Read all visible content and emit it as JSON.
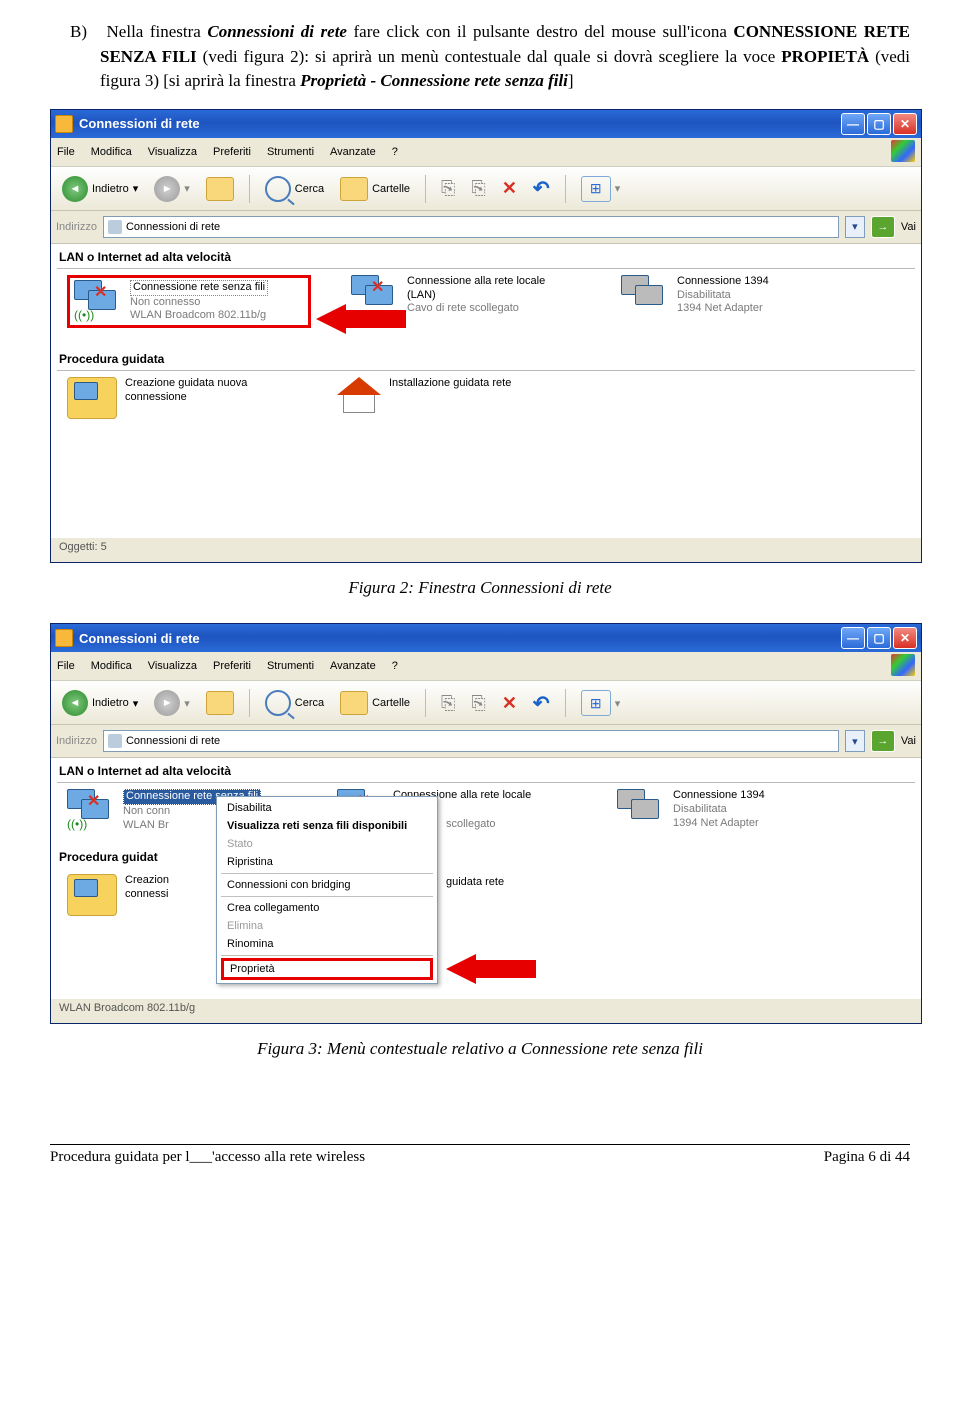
{
  "para": {
    "label": "B)",
    "t1": "Nella finestra ",
    "t2": "Connessioni di rete",
    "t3": " fare click con il pulsante destro del mouse sull'icona ",
    "t4": "CONNESSIONE RETE SENZA FILI",
    "t5": " (vedi figura 2): si aprirà un menù contestuale dal quale si dovrà scegliere la voce ",
    "t6": "PROPIETÀ",
    "t7": " (vedi figura 3) [si aprirà la finestra ",
    "t8": "Proprietà - Connessione rete senza fili",
    "t9": "]"
  },
  "win": {
    "title": "Connessioni di rete",
    "menu": [
      "File",
      "Modifica",
      "Visualizza",
      "Preferiti",
      "Strumenti",
      "Avanzate",
      "?"
    ],
    "back": "Indietro",
    "search": "Cerca",
    "folders": "Cartelle",
    "addr_label": "Indirizzo",
    "addr_value": "Connessioni di rete",
    "go": "Vai",
    "section1": "LAN o Internet ad alta velocità",
    "section2": "Procedura guidata",
    "conn1": {
      "l1": "Connessione rete senza fili",
      "l2": "Non connesso",
      "l3": "WLAN Broadcom 802.11b/g"
    },
    "conn2": {
      "l1": "Connessione alla rete locale",
      "l1b": "(LAN)",
      "l2": "Cavo di rete scollegato"
    },
    "conn3": {
      "l1": "Connessione 1394",
      "l2": "Disabilitata",
      "l3": "1394 Net Adapter"
    },
    "wiz1": {
      "l1": "Creazione guidata nuova",
      "l2": "connessione"
    },
    "wiz2": {
      "l1": "Installazione guidata rete"
    },
    "status1": "Oggetti: 5",
    "status2": "WLAN Broadcom 802.11b/g",
    "conn1_short2": "Non conn",
    "conn1_short3": "WLAN Br",
    "conn2_full": "Connessione alla rete locale",
    "conn2_partial": "scollegato",
    "wiz1_short1": "Creazion",
    "wiz1_short2": "connessi",
    "wiz2_partial": "guidata rete",
    "section2_short": "Procedura guidat"
  },
  "ctx": {
    "items": [
      "Disabilita",
      "Visualizza reti senza fili disponibili",
      "Stato",
      "Ripristina",
      "Connessioni con bridging",
      "Crea collegamento",
      "Elimina",
      "Rinomina",
      "Proprietà"
    ]
  },
  "cap1": "Figura 2: Finestra Connessioni di rete",
  "cap2": "Figura 3: Menù contestuale relativo a Connessione rete senza fili",
  "footer_left": "Procedura guidata per l___'accesso alla rete wireless",
  "footer_right": "Pagina 6 di 44"
}
